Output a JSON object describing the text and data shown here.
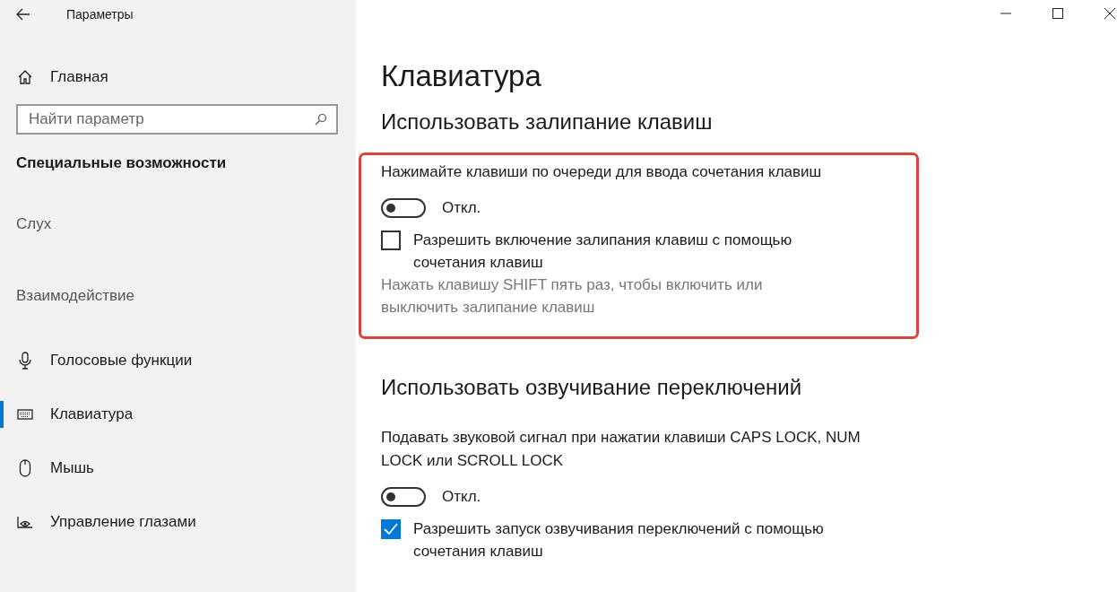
{
  "window": {
    "title": "Параметры"
  },
  "sidebar": {
    "home": "Главная",
    "search": {
      "placeholder": "Найти параметр"
    },
    "category": "Специальные возможности",
    "groups": [
      {
        "heading": "Слух"
      },
      {
        "heading": "Взаимодействие",
        "items": [
          {
            "label": "Голосовые функции",
            "selected": false
          },
          {
            "label": "Клавиатура",
            "selected": true
          },
          {
            "label": "Мышь",
            "selected": false
          },
          {
            "label": "Управление глазами",
            "selected": false
          }
        ]
      }
    ]
  },
  "page_title": "Клавиатура",
  "sections": [
    {
      "heading": "Использовать залипание клавиш",
      "highlighted": true,
      "settings": [
        {
          "kind": "toggle",
          "label": "Нажимайте клавиши по очереди для ввода сочетания клавиш",
          "on": false,
          "state_text": "Откл."
        },
        {
          "kind": "checkbox",
          "label": "Разрешить включение залипания клавиш с помощью сочетания клавиш",
          "checked": false,
          "description": "Нажать клавишу SHIFT пять раз, чтобы включить или выключить залипание клавиш"
        }
      ]
    },
    {
      "heading": "Использовать озвучивание переключений",
      "highlighted": false,
      "settings": [
        {
          "kind": "toggle",
          "label": "Подавать звуковой сигнал при нажатии клавиши CAPS LOCK, NUM LOCK или SCROLL LOCK",
          "on": false,
          "state_text": "Откл."
        },
        {
          "kind": "checkbox",
          "label": "Разрешить запуск озвучивания переключений с помощью сочетания клавиш",
          "checked": true
        }
      ]
    }
  ]
}
